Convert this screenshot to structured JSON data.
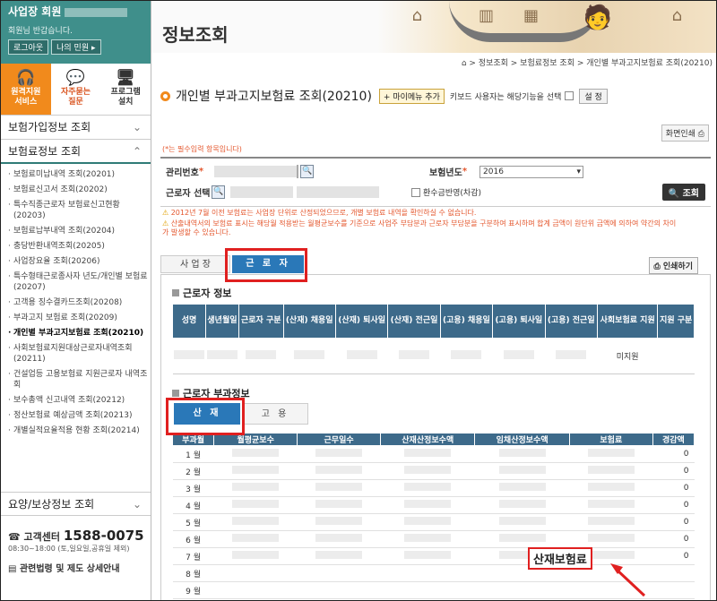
{
  "sidebar": {
    "user_role": "사업장 회원",
    "welcome": "회원님 반갑습니다.",
    "logout_label": "로그아웃",
    "mypage_label": "나의 민원",
    "quick": [
      {
        "label": "원격지원\n서비스",
        "icon": "headset-icon"
      },
      {
        "label": "자주묻는\n질문",
        "icon": "chat-icon"
      },
      {
        "label": "프로그램\n설치",
        "icon": "monitor-icon"
      }
    ],
    "menu_subscription": "보험가입정보 조회",
    "menu_insurance": "보험료정보 조회",
    "submenu": [
      "보험료미납내역 조회(20201)",
      "보험료신고서 조회(20202)",
      "특수직종근로자 보험료신고현황(20203)",
      "보험료납부내역 조회(20204)",
      "충당반환내역조회(20205)",
      "사업장요율 조회(20206)",
      "특수형태근로종사자 년도/개인별 보험료(20207)",
      "고객용 징수결카드조회(20208)",
      "부과고지 보험료 조회(20209)",
      "개인별 부과고지보험료 조회(20210)",
      "사회보험료지원대상근로자내역조회(20211)",
      "건설업등 고용보험료 지원근로자 내역조회",
      "보수총액 신고내역 조회(20212)",
      "정산보험료 예상금액 조회(20213)",
      "개별실적요율적용 현황 조회(20214)"
    ],
    "current_index": 9,
    "menu_compensation": "요양/보상정보 조회",
    "callcenter_label": "고객센터",
    "callcenter_number": "1588-0075",
    "hours": "08:30~18:00 (토,일요일,공휴일 제외)",
    "law_label": "관련법령 및 제도 상세안내"
  },
  "header": {
    "title": "정보조회",
    "breadcrumb": "⌂ > 정보조회 > 보험료정보 조회 > 개인별 부과고지보험료 조회(20210)"
  },
  "page": {
    "title": "개인별 부과고지보험료 조회(20210)",
    "add_fav": "+ 마이메뉴 추가",
    "keyboard_text": "키보드 사용자는 해당기능을 선택",
    "settings": "설 정",
    "print_screen": "화면인쇄",
    "required_note": "(*는 필수입력 항목입니다)"
  },
  "form": {
    "mgmt_label": "관리번호",
    "year_label": "보험년도",
    "year_value": "2016",
    "worker_label": "근로자 선택",
    "refund_label": "환수금반영(차감)",
    "search_label": "조회"
  },
  "notices": [
    "2012년 7월 이전 보험료는 사업장 단위로 산정되었으므로, 개별 보험료 내역을 확인하실 수 없습니다.",
    "산출내역서의 보험료 표시는 해당월 적용받는 월평균보수를 기준으로 사업주 부담분과 근로자 부담분을 구분하여 표시하며 합계 금액이 원단위 금액에 의하여 약간의 차이가 발생할 수 있습니다."
  ],
  "tabs": {
    "business": "사 업 장",
    "worker": "근 로 자"
  },
  "print_label": "인쇄하기",
  "worker_info": {
    "heading": "근로자 정보",
    "columns": [
      "성명",
      "생년월일",
      "근로자 구분",
      "(산재) 채용일",
      "(산재) 퇴사일",
      "(산재) 전근일",
      "(고용) 채용일",
      "(고용) 퇴사일",
      "(고용) 전근일",
      "사회보험료 지원",
      "지원 구분"
    ],
    "support_value": "미지원"
  },
  "premium": {
    "heading": "근로자 부과정보",
    "tab_sanjae": "산 재",
    "tab_goyong": "고 용",
    "columns": [
      "부과월",
      "월평균보수",
      "근무일수",
      "산재산정보수액",
      "임채산정보수액",
      "보험료",
      "경감액"
    ],
    "months": [
      "1 월",
      "2 월",
      "3 월",
      "4 월",
      "5 월",
      "6 월",
      "7 월",
      "8 월",
      "9 월"
    ],
    "reduction": [
      "0",
      "0",
      "0",
      "0",
      "0",
      "0",
      "0",
      "",
      ""
    ]
  },
  "annotation": {
    "label": "산재보험료",
    "color": "#e02020"
  }
}
